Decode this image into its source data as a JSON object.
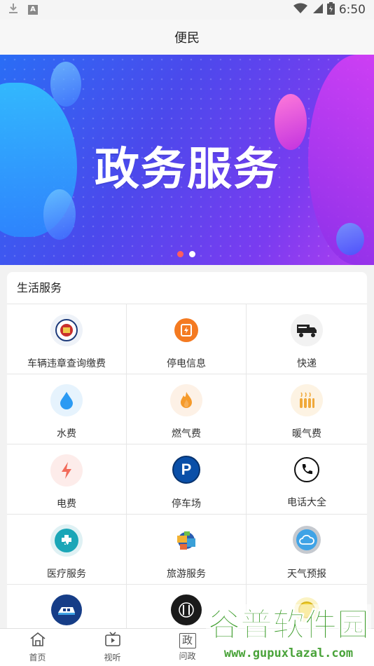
{
  "status_bar": {
    "time": "6:50",
    "letter_badge": "A"
  },
  "header": {
    "title": "便民"
  },
  "banner": {
    "title": "政务服务",
    "slide_count": 2,
    "active_slide": 1
  },
  "life_services": {
    "title": "生活服务",
    "items": [
      {
        "label": "车辆违章查询缴费",
        "icon": "police-badge-icon"
      },
      {
        "label": "停电信息",
        "icon": "power-notice-icon"
      },
      {
        "label": "快递",
        "icon": "delivery-truck-icon"
      },
      {
        "label": "水费",
        "icon": "water-drop-icon"
      },
      {
        "label": "燃气费",
        "icon": "flame-icon"
      },
      {
        "label": "暖气费",
        "icon": "radiator-icon"
      },
      {
        "label": "电费",
        "icon": "lightning-icon"
      },
      {
        "label": "停车场",
        "icon": "parking-icon"
      },
      {
        "label": "电话大全",
        "icon": "phone-icon"
      },
      {
        "label": "医疗服务",
        "icon": "medical-icon"
      },
      {
        "label": "旅游服务",
        "icon": "travel-icon"
      },
      {
        "label": "天气预报",
        "icon": "weather-cloud-icon"
      },
      {
        "label": "",
        "icon": "bus-icon"
      },
      {
        "label": "",
        "icon": "dining-icon"
      },
      {
        "label": "",
        "icon": "coin-icon"
      }
    ]
  },
  "tabbar": {
    "tabs": [
      {
        "label": "首页",
        "icon": "home-icon"
      },
      {
        "label": "视听",
        "icon": "tv-icon"
      },
      {
        "label": "问政",
        "icon": "zheng-icon",
        "glyph": "政"
      }
    ]
  },
  "watermark": {
    "text": "谷普软件园",
    "url": "www.gupuxlazal.com"
  },
  "colors": {
    "accent_red": "#ff5e5e",
    "banner_start": "#2a6df5",
    "banner_end": "#b23ef0"
  }
}
